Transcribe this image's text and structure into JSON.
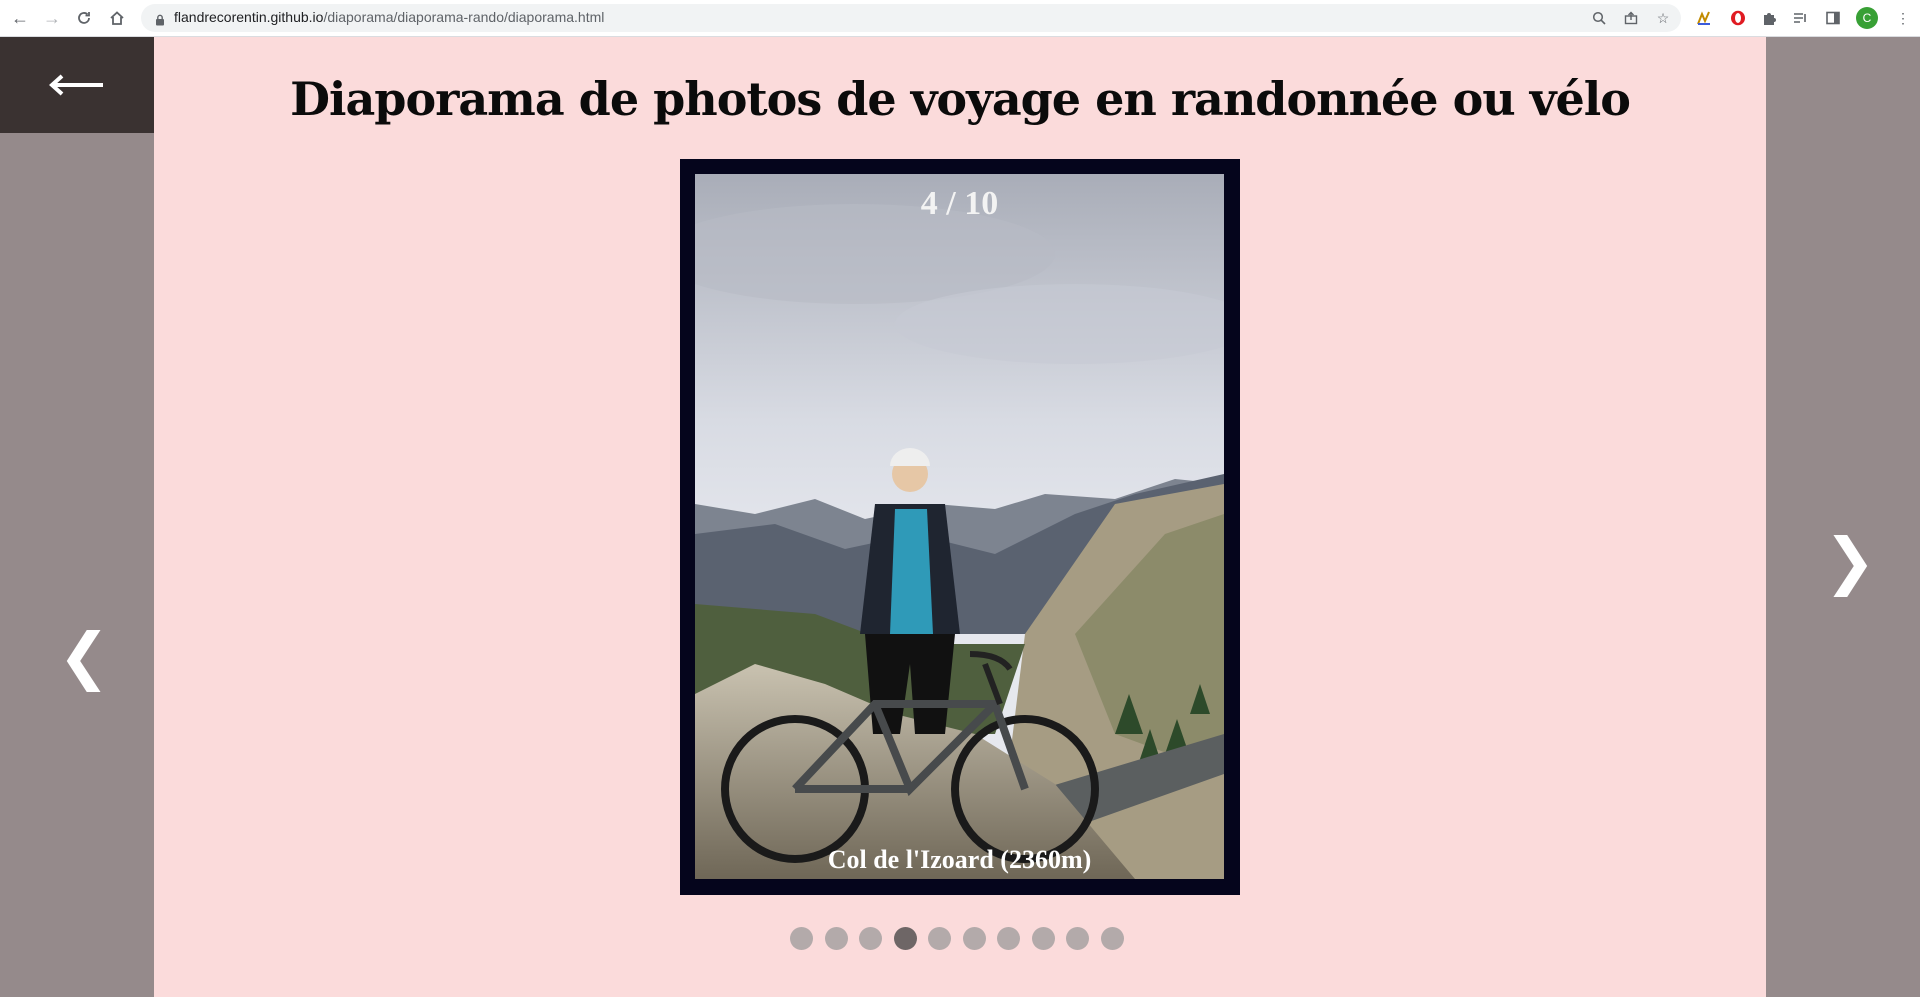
{
  "browser": {
    "url_host": "flandrecorentin.github.io",
    "url_path": "/diaporama/diaporama-rando/diaporama.html",
    "profile_initial": "C"
  },
  "page": {
    "title": "Diaporama de photos de voyage en randonnée ou vélo",
    "back_icon": "arrow-left-icon",
    "prev_glyph": "❮",
    "next_glyph": "❯"
  },
  "slideshow": {
    "counter": "4 / 10",
    "caption": "Col de l'Izoard (2360m)",
    "current_index": 4,
    "total": 10,
    "dots": [
      {
        "active": false
      },
      {
        "active": false
      },
      {
        "active": false
      },
      {
        "active": true
      },
      {
        "active": false
      },
      {
        "active": false
      },
      {
        "active": false
      },
      {
        "active": false
      },
      {
        "active": false
      },
      {
        "active": false
      }
    ]
  },
  "colors": {
    "background_main": "#fbdbdb",
    "side_bars": "#958a8b",
    "back_box": "#3a3231",
    "frame": "#05051c",
    "dot": "#b3aaaa",
    "dot_active": "#6e6666"
  }
}
